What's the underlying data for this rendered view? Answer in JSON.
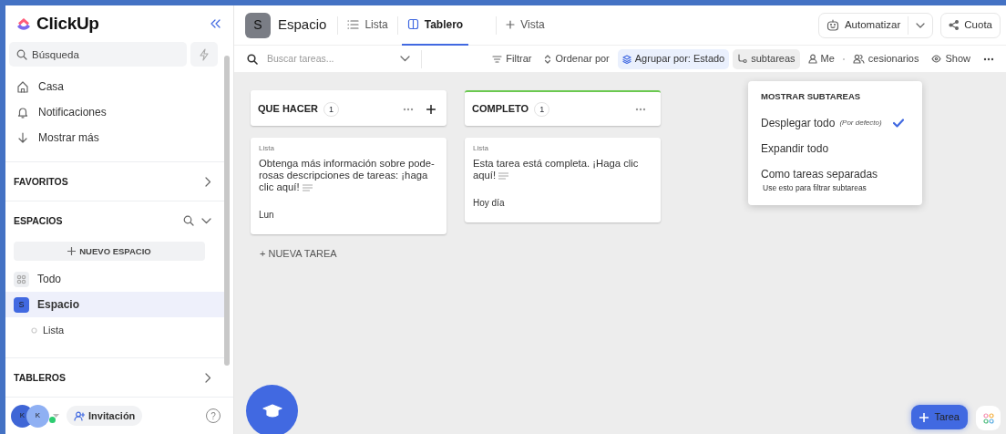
{
  "sidebar": {
    "logo": "ClickUp",
    "search": {
      "placeholder": "Búsqueda"
    },
    "nav": [
      {
        "kind": "home",
        "label": "Casa"
      },
      {
        "kind": "bell",
        "label": "Notificaciones"
      },
      {
        "kind": "down",
        "label": "Mostrar más"
      }
    ],
    "favorites": {
      "label": "FAVORITOS"
    },
    "spaces": {
      "label": "ESPACIOS",
      "new_button": "NUEVO ESPACIO",
      "items": [
        {
          "kind": "all",
          "label": "Todo",
          "selected": false
        },
        {
          "kind": "space",
          "badge": "S",
          "label": "Espacio",
          "selected": true,
          "children": [
            {
              "label": "Lista",
              "selected": false
            }
          ]
        }
      ]
    },
    "boards": {
      "label": "TABLEROS"
    },
    "footer": {
      "avatars": [
        "K",
        "K"
      ],
      "invite": "Invitación",
      "help": "?"
    }
  },
  "header": {
    "space_badge": "S",
    "space_name": "Espacio",
    "views": [
      {
        "kind": "list",
        "label": "Lista",
        "selected": false
      },
      {
        "kind": "board",
        "label": "Tablero",
        "selected": true
      }
    ],
    "add_view": "Vista",
    "automate": "Automatizar",
    "share": "Cuota"
  },
  "toolbar": {
    "search": {
      "placeholder": "Buscar tareas..."
    },
    "items": [
      {
        "kind": "filter",
        "label": "Filtrar",
        "active": false
      },
      {
        "kind": "sort",
        "label": "Ordenar por",
        "active": false
      },
      {
        "kind": "group",
        "label": "Agrupar por: Estado",
        "active": true
      },
      {
        "kind": "subtasks",
        "label": "subtareas",
        "active": true
      },
      {
        "kind": "me",
        "label": "Me",
        "active": false
      },
      {
        "kind": "assignees",
        "label": "cesionarios",
        "active": false
      },
      {
        "kind": "show",
        "label": "Show",
        "active": false
      }
    ]
  },
  "board": {
    "columns": [
      {
        "title": "QUE HACER",
        "count": "1",
        "color": "#ffffff",
        "can_add": true,
        "new_task": "+ NUEVA TAREA",
        "cards": [
          {
            "list": "Lista",
            "title": "Obtenga más información sobre pode-rosas descripciones de tareas: ¡haga clic aquí!",
            "date": "Lun"
          }
        ]
      },
      {
        "title": "COMPLETO",
        "count": "1",
        "color": "#6bc950",
        "can_add": false,
        "cards": [
          {
            "list": "Lista",
            "title": "Esta tarea está completa. ¡Haga clic aquí!",
            "date": "Hoy día"
          }
        ]
      }
    ]
  },
  "subtasks_menu": {
    "title": "MOSTRAR SUBTAREAS",
    "options": [
      {
        "label": "Desplegar todo",
        "note": "(Por defecto)",
        "selected": true
      },
      {
        "label": "Expandir todo",
        "selected": false
      },
      {
        "label": "Como tareas separadas",
        "hint": "Use esto para filtrar subtareas",
        "selected": false
      }
    ]
  },
  "task_button": "Tarea"
}
